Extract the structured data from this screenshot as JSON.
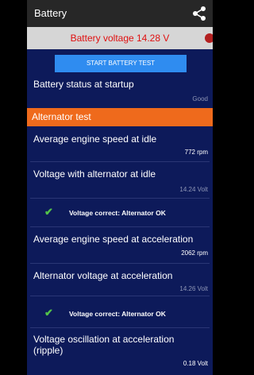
{
  "appbar": {
    "title": "Battery"
  },
  "banner": {
    "voltage_text": "Battery voltage 14.28 V"
  },
  "buttons": {
    "start_test": "START BATTERY TEST"
  },
  "status": {
    "label": "Battery status at startup",
    "value": "Good"
  },
  "section": {
    "title": "Alternator test"
  },
  "rows": {
    "idle_speed": {
      "label": "Average engine speed at idle",
      "value": "772 rpm"
    },
    "idle_voltage": {
      "label": "Voltage with alternator at idle",
      "value": "14.24 Volt"
    },
    "ok1": {
      "text": "Voltage correct: Alternator OK"
    },
    "accel_speed": {
      "label": "Average engine speed at acceleration",
      "value": "2062 rpm"
    },
    "accel_voltage": {
      "label": "Alternator voltage at acceleration",
      "value": "14.26 Volt"
    },
    "ok2": {
      "text": "Voltage correct: Alternator OK"
    },
    "ripple": {
      "label": "Voltage oscillation at acceleration (ripple)",
      "value": "0.18 Volt"
    }
  },
  "icons": {
    "share": "share-icon",
    "check": "check-icon"
  },
  "colors": {
    "appbar": "#272727",
    "content_bg": "#0d1a5a",
    "section": "#ef6a1c",
    "button": "#2f8cf0",
    "banner_text": "#e01010",
    "check": "#53c24a"
  }
}
